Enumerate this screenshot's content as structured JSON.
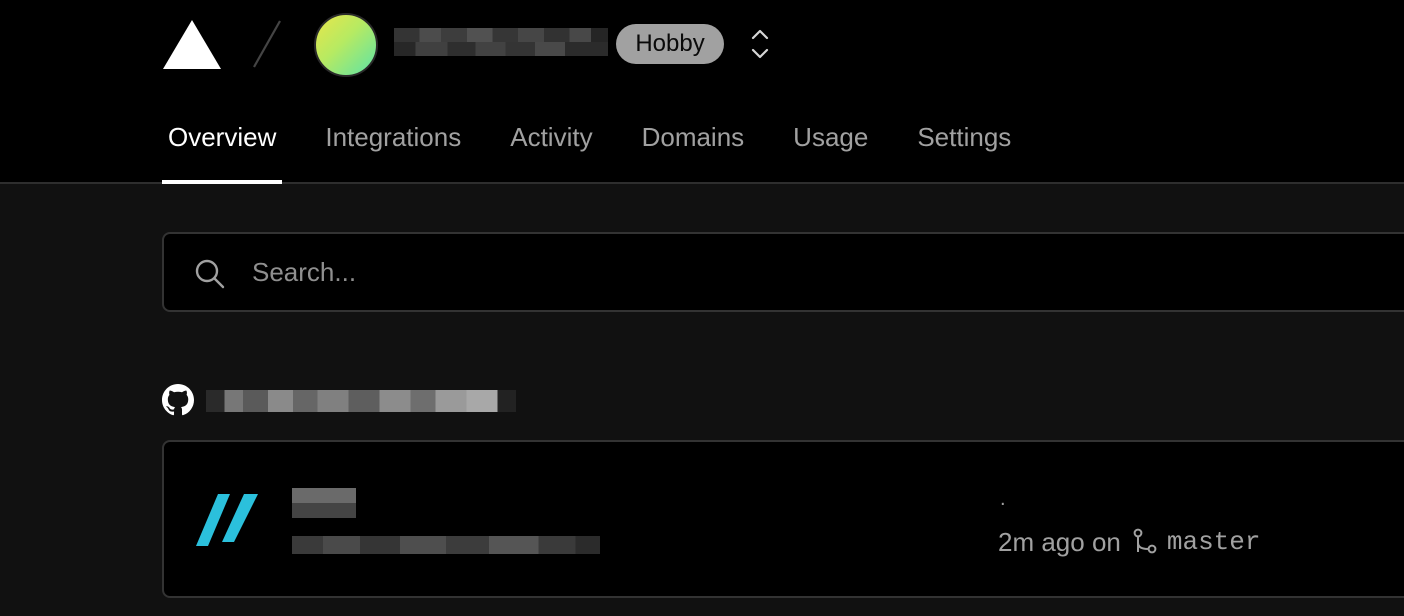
{
  "header": {
    "logo_icon": "vercel-triangle-icon",
    "team_name": "",
    "plan_badge": "Hobby",
    "switcher_icon": "chevron-up-down-icon"
  },
  "tabs": [
    {
      "label": "Overview",
      "active": true
    },
    {
      "label": "Integrations",
      "active": false
    },
    {
      "label": "Activity",
      "active": false
    },
    {
      "label": "Domains",
      "active": false
    },
    {
      "label": "Usage",
      "active": false
    },
    {
      "label": "Settings",
      "active": false
    }
  ],
  "search": {
    "placeholder": "Search...",
    "value": ""
  },
  "repo": {
    "provider_icon": "github-icon",
    "name": ""
  },
  "project": {
    "framework_icon": "framework-logo-icon",
    "name": "",
    "url": "",
    "commit_message": ".",
    "time": "2m ago on",
    "branch_icon": "git-branch-icon",
    "branch": "master"
  },
  "colors": {
    "background": "#111111",
    "header_background": "#000000",
    "border": "#333333",
    "muted_text": "#a1a1a1",
    "badge": "#a1a1a1",
    "framework_accent": "#2bc0dc"
  }
}
